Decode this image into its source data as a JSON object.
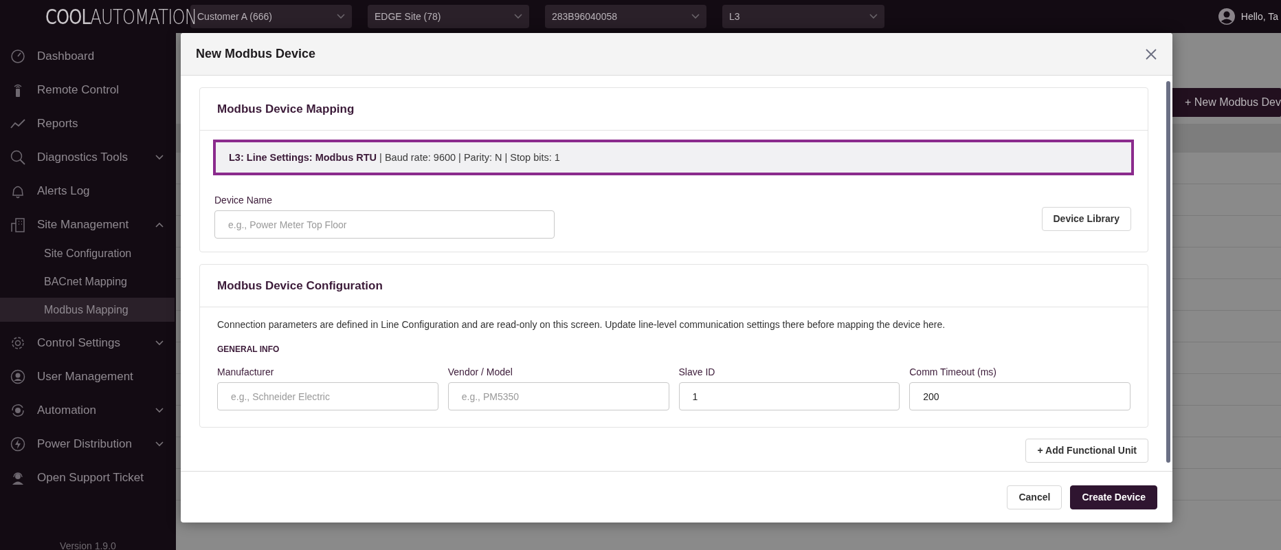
{
  "brand": {
    "logo_text": "**COOL**AUTOMATION"
  },
  "topbar": {
    "selectors": [
      {
        "value": "Customer A (666)"
      },
      {
        "value": "EDGE Site (78)"
      },
      {
        "value": "283B96040058"
      },
      {
        "value": "L3"
      }
    ],
    "greeting": "Hello, Ta"
  },
  "sidebar": {
    "items": [
      {
        "label": "Dashboard",
        "selected": false
      },
      {
        "label": "Remote Control",
        "selected": false
      },
      {
        "label": "Reports",
        "selected": false
      },
      {
        "label": "Diagnostics Tools",
        "selected": false,
        "expanded": false
      },
      {
        "label": "Alerts Log",
        "selected": false
      },
      {
        "label": "Site Management",
        "selected": false,
        "expanded": true,
        "children": [
          {
            "label": "Site Configuration",
            "selected": false
          },
          {
            "label": "BACnet Mapping",
            "selected": false
          },
          {
            "label": "Modbus Mapping",
            "selected": true
          }
        ]
      },
      {
        "label": "Control Settings",
        "selected": false,
        "expanded": false
      },
      {
        "label": "User Management",
        "selected": false
      },
      {
        "label": "Automation",
        "selected": false,
        "expanded": false
      },
      {
        "label": "Power Distribution",
        "selected": false,
        "expanded": false
      },
      {
        "label": "Open Support Ticket",
        "selected": false
      }
    ],
    "version": "Version 1.9.0"
  },
  "page": {
    "new_button": "+ New Modbus Dev"
  },
  "modal": {
    "title": "New Modbus Device",
    "mapping": {
      "title": "Modbus Device Mapping",
      "banner": "**L3: Line Settings: Modbus RTU** | Baud rate: 9600 | Parity: N | Stop bits: 1",
      "device_name": {
        "label": "Device Name",
        "placeholder": "e.g., Power Meter Top Floor"
      },
      "library_button": "Device Library"
    },
    "configuration": {
      "title": "Modbus Device Configuration",
      "description": "Connection parameters are defined in Line Configuration and are read-only on this screen. Update line-level communication settings there before mapping the device here.",
      "group": "GENERAL INFO",
      "fields": [
        {
          "label": "Manufacturer",
          "placeholder": "e.g., Schneider Electric"
        },
        {
          "label": "Vendor / Model",
          "placeholder": "e.g., PM5350"
        },
        {
          "label": "Slave ID",
          "value": "1"
        },
        {
          "label": "Comm Timeout (ms)",
          "value": "200"
        }
      ]
    },
    "add_button": "+ Add Functional Unit",
    "footer_buttons": [
      {
        "label": "Cancel",
        "kind": "secondary"
      },
      {
        "label": "Create Device",
        "kind": "primary"
      }
    ]
  }
}
